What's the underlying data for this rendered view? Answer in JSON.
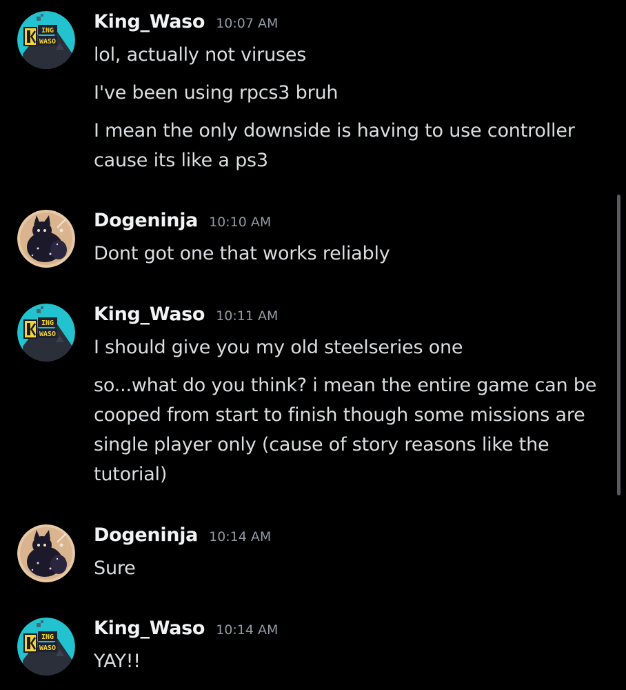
{
  "messages": [
    {
      "author": "King_Waso",
      "time": "10:07 AM",
      "lines": [
        "lol, actually not viruses",
        "I've been using rpcs3 bruh",
        "I mean the only downside is having to use controller cause its like a ps3"
      ]
    },
    {
      "author": "Dogeninja",
      "time": "10:10 AM",
      "lines": [
        "Dont got one that works reliably"
      ]
    },
    {
      "author": "King_Waso",
      "time": "10:11 AM",
      "lines": [
        "I should give you my old steelseries one",
        "so...what do you think? i mean the entire game can be cooped from start to finish though some missions are single player only (cause of story reasons like the tutorial)"
      ]
    },
    {
      "author": "Dogeninja",
      "time": "10:14 AM",
      "lines": [
        "Sure"
      ]
    },
    {
      "author": "King_Waso",
      "time": "10:14 AM",
      "lines": [
        "YAY!!"
      ]
    }
  ],
  "avatars": {
    "king_waso_logo_text": "KING WASO",
    "icon": "king-waso-logo"
  },
  "colors": {
    "background": "#000000",
    "username": "#f2f3f5",
    "timestamp": "#949ba4",
    "message_text": "#dbdee1",
    "king_waso_avatar": "#22c3cf",
    "dogeninja_avatar": "#e8c9a6"
  }
}
